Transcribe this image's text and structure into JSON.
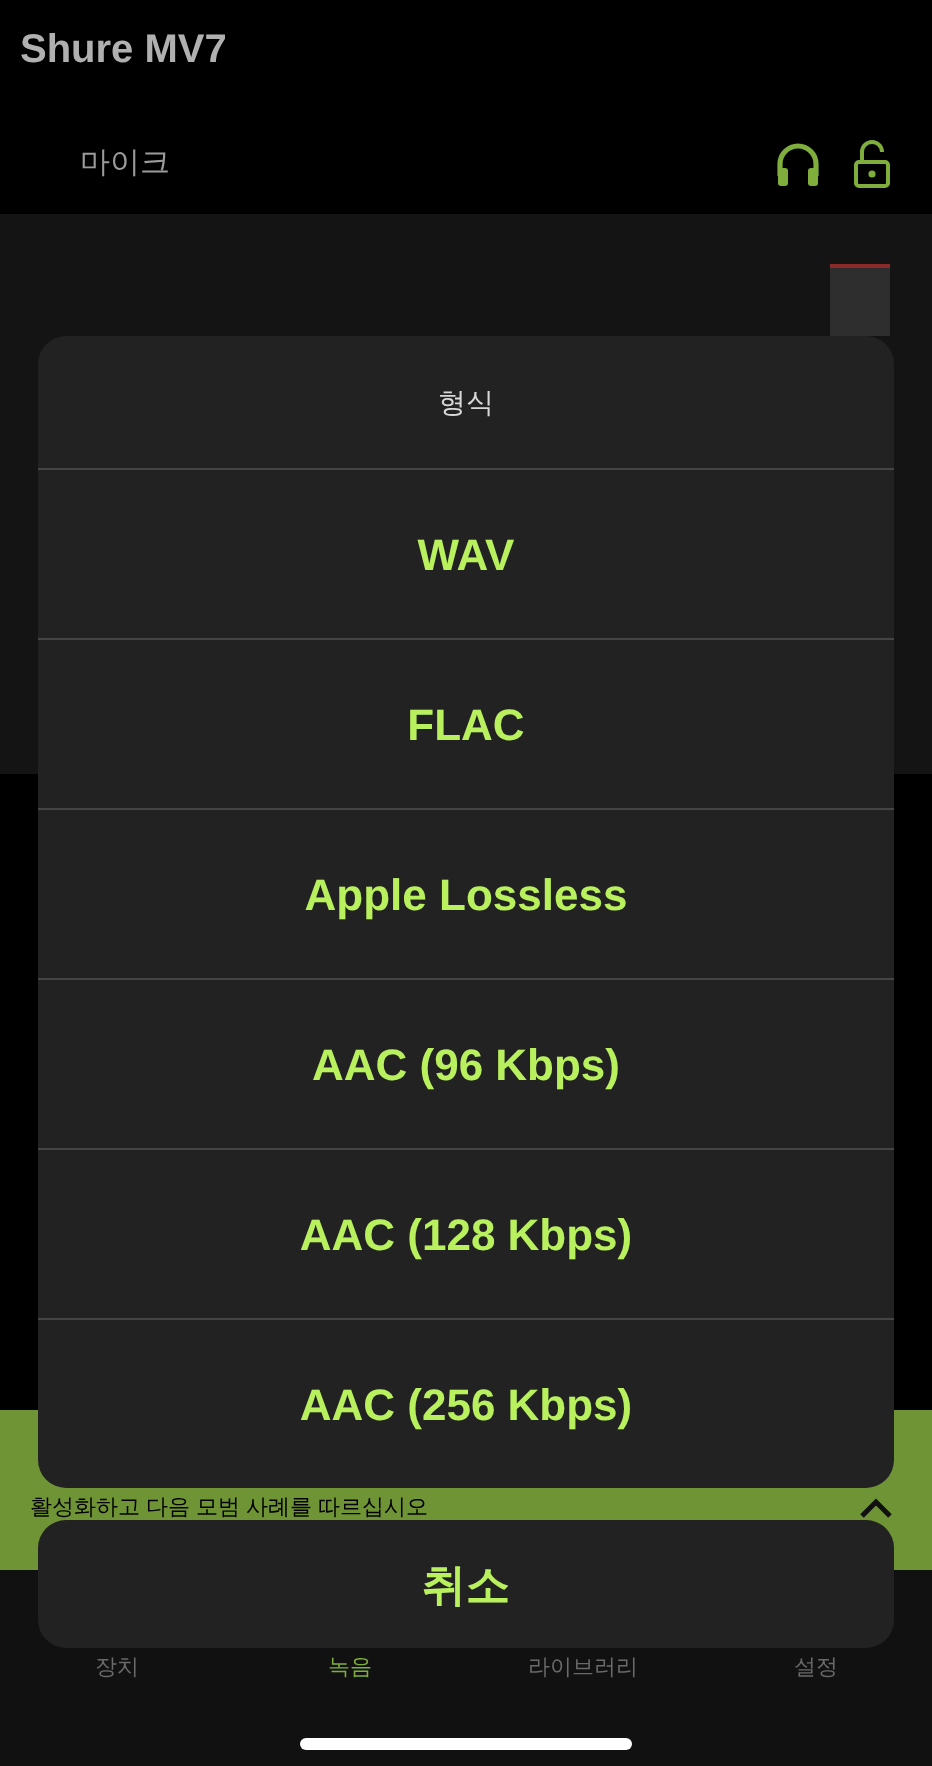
{
  "app_title": "Shure MV7",
  "mic_row": {
    "label": "마이크"
  },
  "banner": {
    "text": "활성화하고 다음 모범 사례를 따르십시오"
  },
  "tab_bar": [
    {
      "label": "장치",
      "selected": false
    },
    {
      "label": "녹음",
      "selected": true
    },
    {
      "label": "라이브러리",
      "selected": false
    },
    {
      "label": "설정",
      "selected": false
    }
  ],
  "action_sheet": {
    "title": "형식",
    "options": [
      "WAV",
      "FLAC",
      "Apple Lossless",
      "AAC (96 Kbps)",
      "AAC (128 Kbps)",
      "AAC (256 Kbps)"
    ],
    "cancel": "취소"
  }
}
